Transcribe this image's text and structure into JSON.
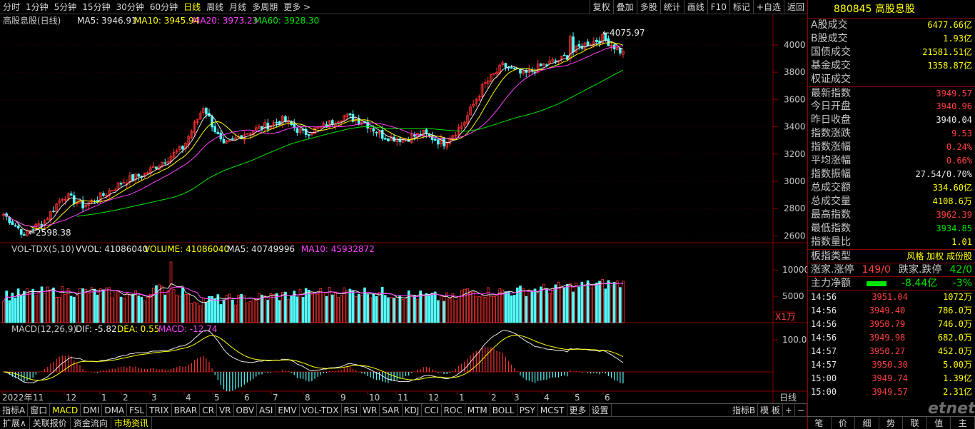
{
  "periods": [
    "分时",
    "1分钟",
    "5分钟",
    "15分钟",
    "30分钟",
    "60分钟",
    "日线",
    "周线",
    "月线",
    "多周期",
    "更多 >"
  ],
  "selected_period": "日线",
  "tools": [
    "复权",
    "叠加",
    "多股",
    "统计",
    "画线",
    "F10",
    "标记",
    "+自选",
    "返回"
  ],
  "legend": {
    "title": "高股息股(日线)",
    "ma5": "MA5: 3946.91",
    "ma10": "MA10: 3945.94",
    "ma20": "MA20: 3973.23",
    "ma60": "MA60: 3928.30"
  },
  "vol_legend": {
    "title": "VOL-TDX(5,10)",
    "vvol": "VVOL: 41086040",
    "volume": "VOLUME: 41086040",
    "ma5": "MA5: 40749996",
    "ma10": "MA10: 45932872"
  },
  "macd_legend": {
    "title": "MACD(12,26,9)",
    "dif": "DIF: -5.82",
    "dea": "DEA: 0.55",
    "macd": "MACD: -12.74"
  },
  "price_axis": [
    "4000",
    "3800",
    "3600",
    "3400",
    "3200",
    "3000",
    "2800",
    "2600"
  ],
  "vol_axis": [
    "10000",
    "5000"
  ],
  "vol_unit": "X1万",
  "macd_axis": [
    "100.0"
  ],
  "high_label": "4075.97",
  "low_label": "2598.38",
  "date_axis": [
    "2022年",
    "11",
    "12",
    "1",
    "2",
    "3",
    "4",
    "5",
    "6",
    "7",
    "8",
    "9",
    "10",
    "11",
    "12",
    "1",
    "2",
    "3",
    "4",
    "5",
    "6"
  ],
  "date_axis_right": "日线",
  "chart_data": {
    "type": "candlestick",
    "title": "高股息股(日线)",
    "y_range": [
      2550,
      4120
    ],
    "low": 2598.38,
    "high": 4075.97,
    "anchor_close": [
      2760,
      2620,
      2700,
      2900,
      2820,
      2900,
      3000,
      3050,
      3150,
      3250,
      3550,
      3250,
      3350,
      3400,
      3450,
      3350,
      3400,
      3480,
      3440,
      3330,
      3310,
      3350,
      3280,
      3420,
      3700,
      3850,
      3780,
      3850,
      3900,
      4000,
      4050,
      3940
    ]
  },
  "indicator_tabs": [
    "指标A",
    "窗口",
    "MACD",
    "DMI",
    "DMA",
    "FSL",
    "TRIX",
    "BRAR",
    "CR",
    "VR",
    "OBV",
    "ASI",
    "EMV",
    "VOL-TDX",
    "RSI",
    "WR",
    "SAR",
    "KDJ",
    "CCI",
    "ROC",
    "MTM",
    "BOLL",
    "PSY",
    "MCST",
    "更多",
    "设置"
  ],
  "indicator_right": [
    "指标B",
    "模 板",
    "+",
    "−"
  ],
  "bottom_tabs": [
    "扩展∧",
    "关联报价",
    "资金流向",
    "市场资讯"
  ],
  "stock": {
    "code": "880845",
    "name": "高股息股"
  },
  "stats": [
    {
      "k": "A股成交",
      "v": "6477.66亿",
      "c": "y"
    },
    {
      "k": "B股成交",
      "v": "1.93亿",
      "c": "y"
    },
    {
      "k": "国债成交",
      "v": "21581.51亿",
      "c": "y"
    },
    {
      "k": "基金成交",
      "v": "1358.87亿",
      "c": "y"
    },
    {
      "k": "权证成交",
      "v": "",
      "c": "y"
    },
    {
      "k": "最新指数",
      "v": "3949.57",
      "c": "r"
    },
    {
      "k": "今日开盘",
      "v": "3940.96",
      "c": "r"
    },
    {
      "k": "昨日收盘",
      "v": "3940.04",
      "c": "w"
    },
    {
      "k": "指数涨跌",
      "v": "9.53",
      "c": "r"
    },
    {
      "k": "指数涨幅",
      "v": "0.24%",
      "c": "r"
    },
    {
      "k": "平均涨幅",
      "v": "0.66%",
      "c": "r"
    },
    {
      "k": "指数振幅",
      "v": "27.54/0.70%",
      "c": "w"
    },
    {
      "k": "总成交额",
      "v": "334.60亿",
      "c": "y"
    },
    {
      "k": "总成交量",
      "v": "4108.6万",
      "c": "y"
    },
    {
      "k": "最高指数",
      "v": "3962.39",
      "c": "r"
    },
    {
      "k": "最低指数",
      "v": "3934.85",
      "c": "g"
    },
    {
      "k": "指数量比",
      "v": "1.01",
      "c": "y"
    }
  ],
  "board": {
    "k": "板指类型",
    "v": "风格 加权 成份股"
  },
  "updown": {
    "k1": "涨家.涨停",
    "v1": "149/0",
    "k2": "跌家.跌停",
    "v2": "42/0"
  },
  "mainflow": {
    "k": "主力净额",
    "v": "-8.44亿",
    "p": "-3%"
  },
  "ticks": [
    {
      "t": "14:56",
      "p": "3951.04",
      "v": "1072万"
    },
    {
      "t": "14:56",
      "p": "3949.40",
      "v": "786.0万"
    },
    {
      "t": "14:56",
      "p": "3950.79",
      "v": "746.0万"
    },
    {
      "t": "14:56",
      "p": "3949.98",
      "v": "682.0万"
    },
    {
      "t": "14:57",
      "p": "3950.27",
      "v": "452.0万"
    },
    {
      "t": "14:57",
      "p": "3950.30",
      "v": "5.00万"
    },
    {
      "t": "15:00",
      "p": "3949.74",
      "v": "1.39亿"
    },
    {
      "t": "15:00",
      "p": "3949.57",
      "v": "2.31亿"
    }
  ],
  "right_tabs": [
    "笔",
    "价",
    "细",
    "势",
    "联",
    "值",
    "主"
  ],
  "watermark": "etnet"
}
